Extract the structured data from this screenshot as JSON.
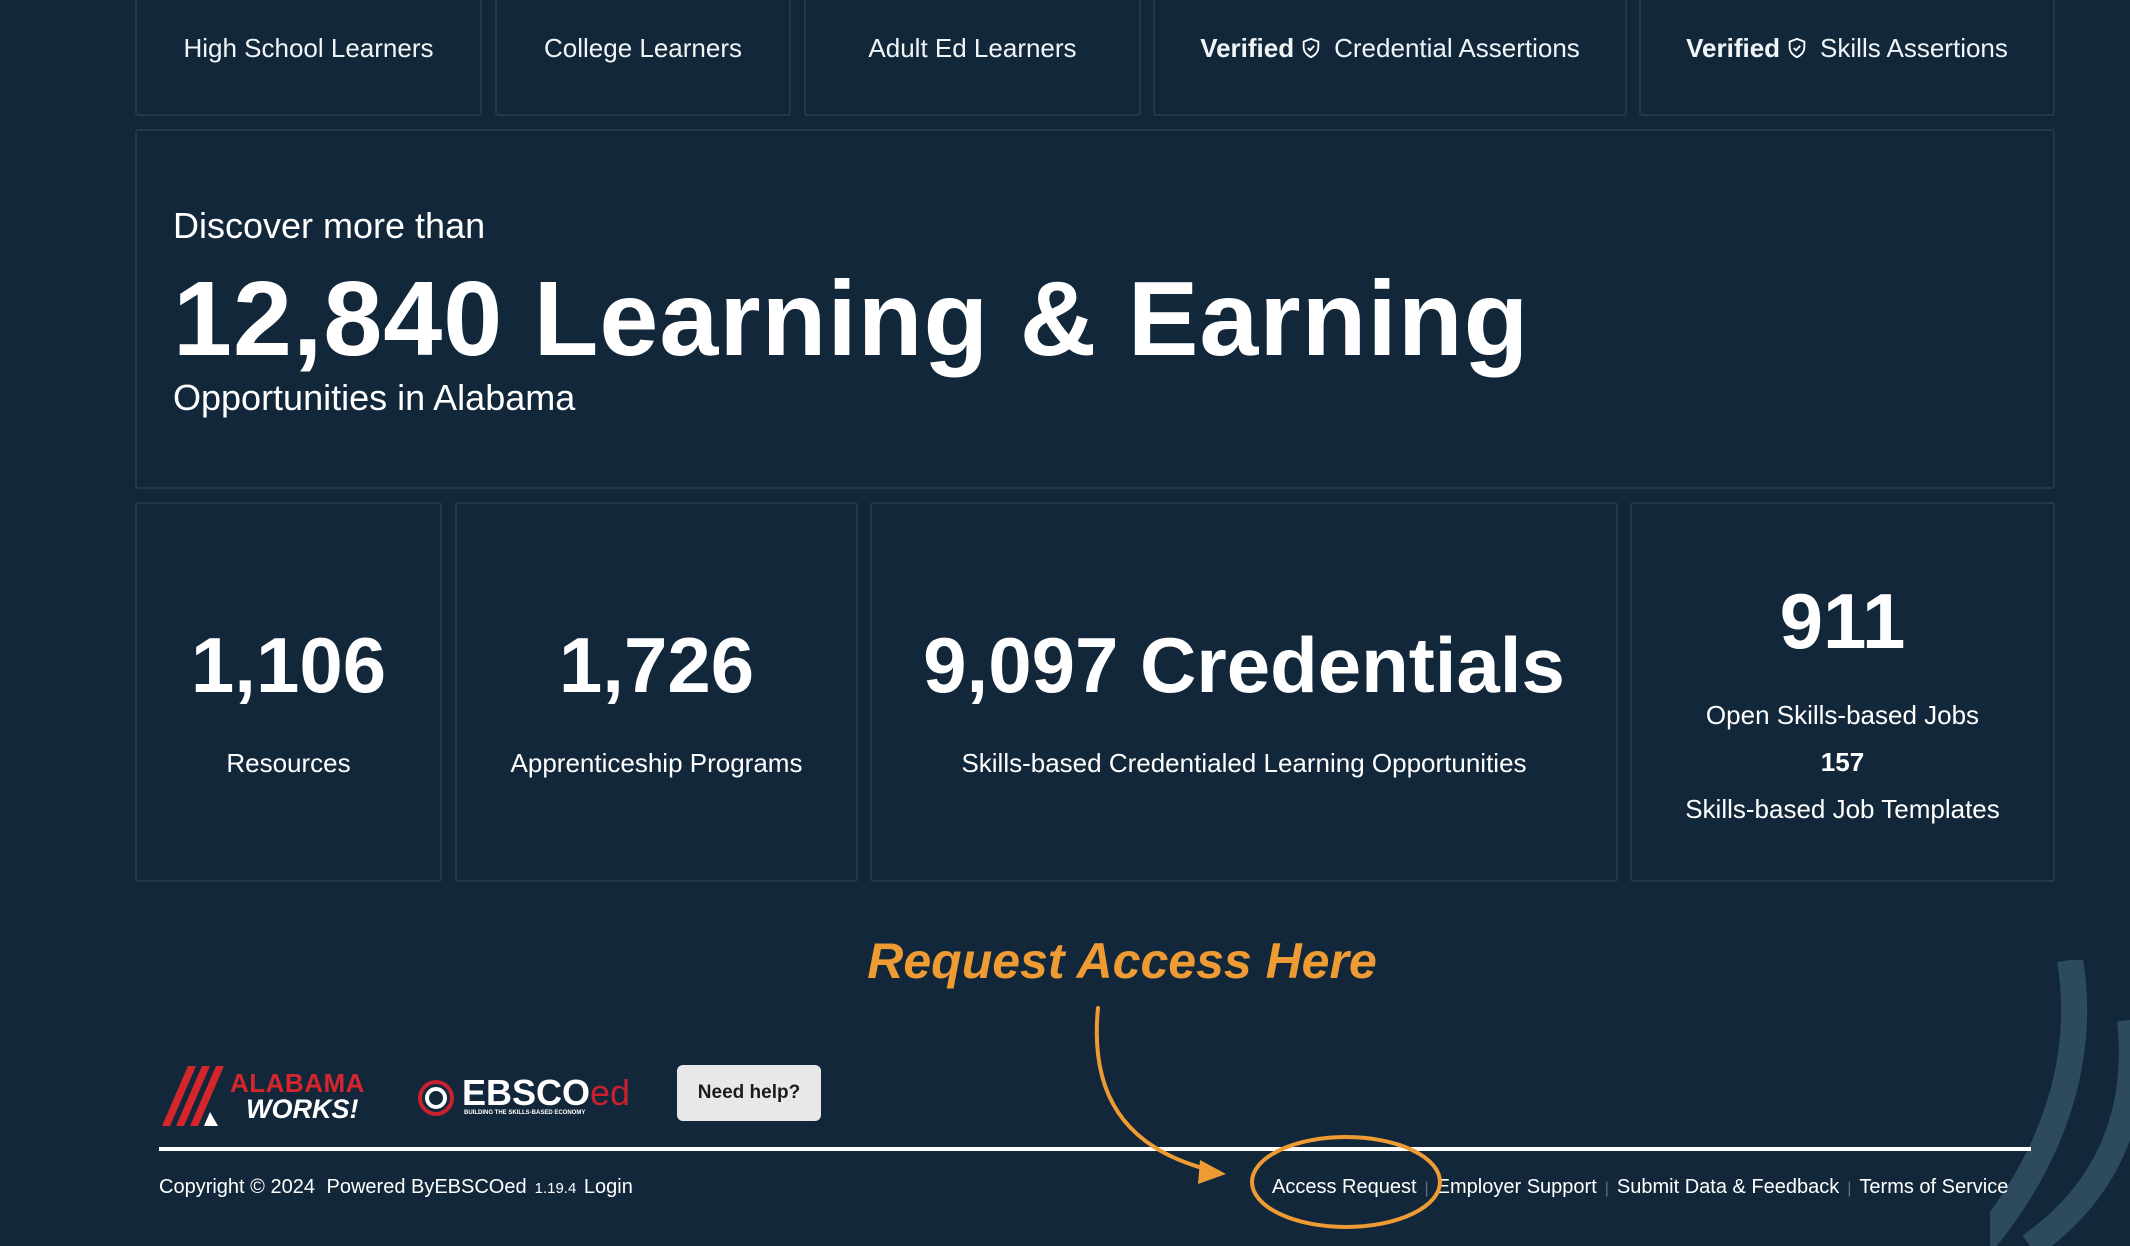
{
  "tabs": [
    {
      "label": "High School Learners"
    },
    {
      "label": "College Learners"
    },
    {
      "label": "Adult Ed Learners"
    },
    {
      "verified": "Verified",
      "label": "Credential Assertions"
    },
    {
      "verified": "Verified",
      "label": "Skills Assertions"
    }
  ],
  "hero": {
    "pre": "Discover more than",
    "headline": "12,840 Learning & Earning",
    "post": "Opportunities in Alabama"
  },
  "stats": [
    {
      "value": "1,106",
      "label": "Resources"
    },
    {
      "value": "1,726",
      "label": "Apprenticeship Programs"
    },
    {
      "value": "9,097 Credentials",
      "label": "Skills-based Credentialed Learning Opportunities"
    },
    {
      "value": "911",
      "label": "Open Skills-based Jobs",
      "value2": "157",
      "label2": "Skills-based Job Templates"
    }
  ],
  "callout": "Request Access Here",
  "logos": {
    "alabama_line1": "ALABAMA",
    "alabama_line2": "WORKS!",
    "ebsco_main": "EBSCO",
    "ebsco_suffix": "ed",
    "ebsco_tagline": "BUILDING THE SKILLS-BASED ECONOMY"
  },
  "need_help": "Need help?",
  "footer": {
    "copyright": "Copyright © 2024",
    "powered": "Powered ByEBSCOed",
    "version": "1.19.4",
    "login": "Login",
    "links": [
      "Access Request",
      "Employer Support",
      "Submit Data & Feedback",
      "Terms of Service"
    ],
    "separator": "|"
  },
  "colors": {
    "background": "#12283a",
    "card_border": "#22394c",
    "accent_orange": "#ef9b34",
    "alabama_red": "#d5262c",
    "ebsco_red": "#c8202f"
  },
  "icons": [
    "shield-check-icon",
    "arrow-curve-icon"
  ]
}
